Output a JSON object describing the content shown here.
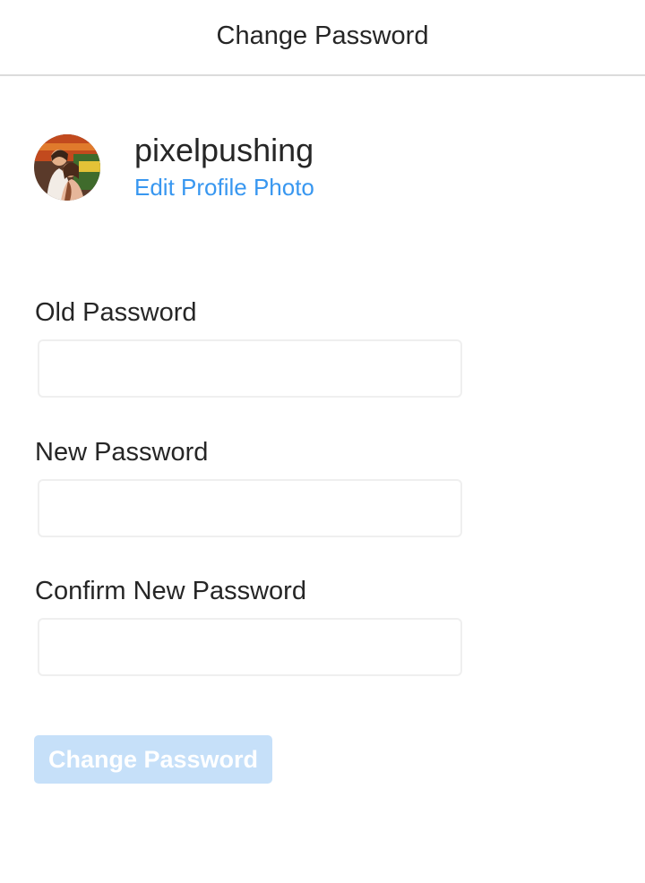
{
  "header": {
    "title": "Change Password"
  },
  "profile": {
    "username": "pixelpushing",
    "edit_photo_label": "Edit Profile Photo",
    "avatar_icon": "profile-photo"
  },
  "form": {
    "fields": [
      {
        "label": "Old Password",
        "value": "",
        "type": "password"
      },
      {
        "label": "New Password",
        "value": "",
        "type": "password"
      },
      {
        "label": "Confirm New Password",
        "value": "",
        "type": "password"
      }
    ],
    "submit_label": "Change Password",
    "submit_enabled": false
  },
  "colors": {
    "link": "#3897f0",
    "button_disabled": "#c6e0f9",
    "border": "#dbdbdb",
    "text": "#262626"
  }
}
